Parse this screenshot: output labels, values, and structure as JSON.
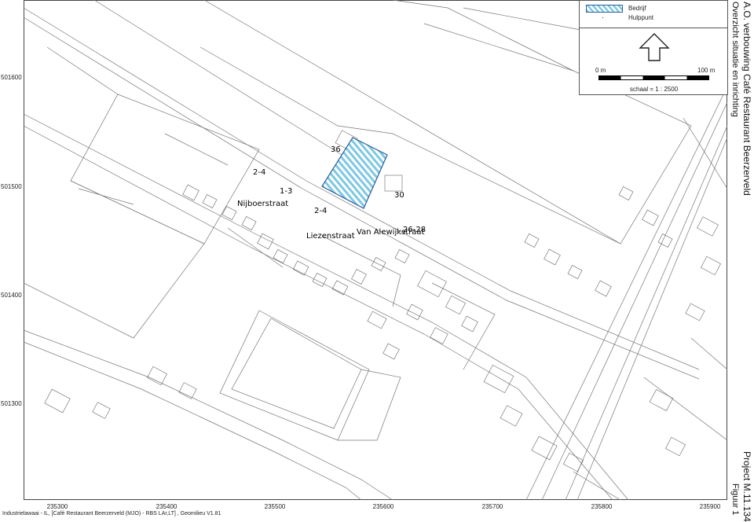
{
  "axes": {
    "y_ticks": [
      "501600",
      "501500",
      "501400",
      "501300"
    ],
    "x_ticks": [
      "235300",
      "235400",
      "235500",
      "235600",
      "235700",
      "235800",
      "235900"
    ]
  },
  "streets": {
    "nijboerstraat": "Nijboerstraat",
    "liezenstraat": "Liezenstraat",
    "van_alewijkstraat": "Van Alewijkstraat"
  },
  "house_numbers": {
    "n36": "36",
    "n2_4_a": "2-4",
    "n1_3": "1-3",
    "n2_4_b": "2-4",
    "n30": "30",
    "n26_28": "26-28"
  },
  "legend": {
    "bedrijf": "Bedrijf",
    "hulppunt": "Hulppunt",
    "scale_start": "0 m",
    "scale_end": "100 m",
    "scale_text": "schaal = 1 : 2500",
    "hatch_color": "#7ec8e3"
  },
  "title": {
    "main": "A.O. verbouwing Café Restaurant Beerzerveld",
    "sub": "Overzicht situatie en inrichting",
    "project": "Project M.11.134",
    "figure": "Figuur 1"
  },
  "footer": "Industrielawaai - IL, [Café Restaurant Beerzerveld (MJO) - RBS LAr,LT] , Geomilieu V1.81"
}
